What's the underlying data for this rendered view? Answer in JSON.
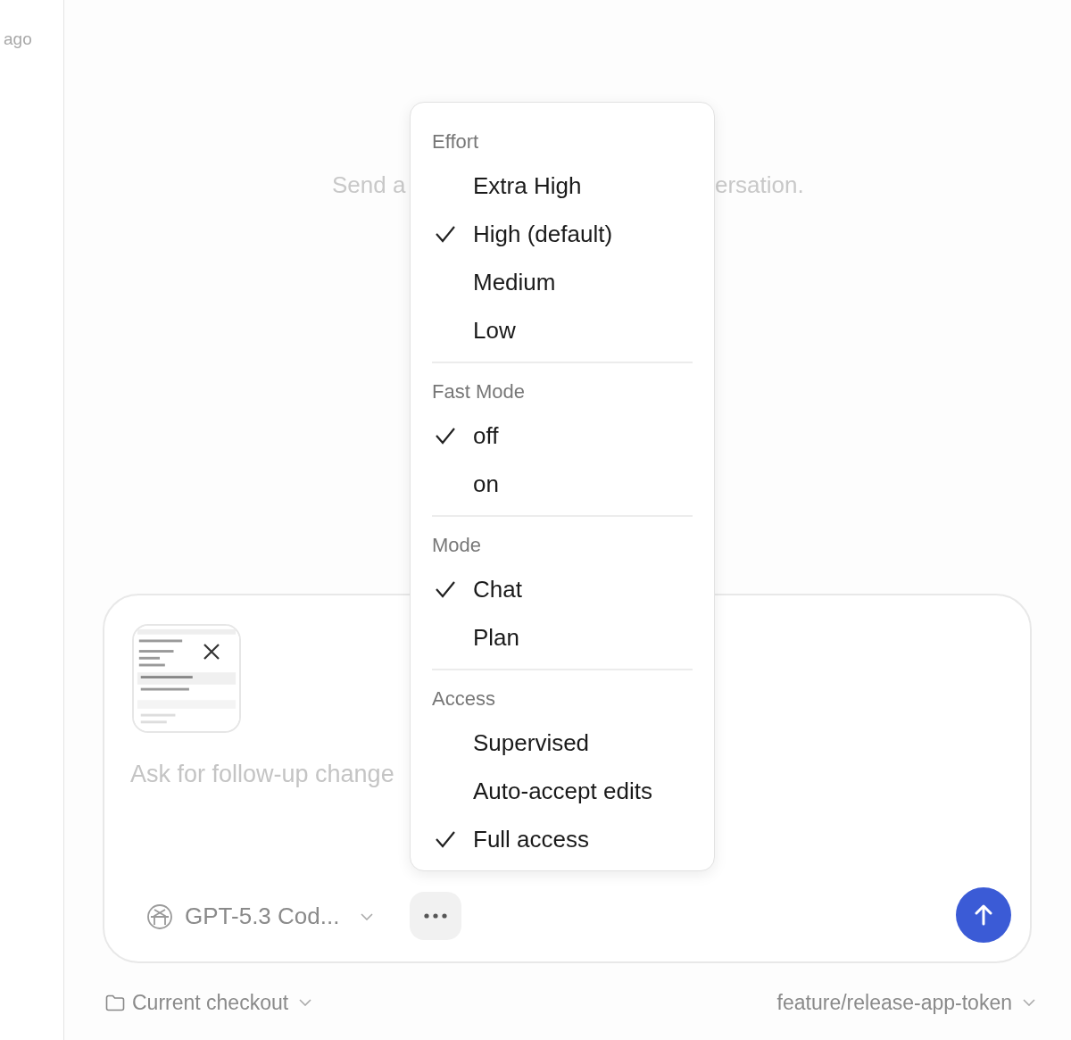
{
  "sidebar": {
    "time": "ago"
  },
  "empty_state": {
    "left": "Send a",
    "right": "ersation."
  },
  "menu": {
    "sections": [
      {
        "title": "Effort",
        "items": [
          {
            "label": "Extra High",
            "selected": false
          },
          {
            "label": "High (default)",
            "selected": true
          },
          {
            "label": "Medium",
            "selected": false
          },
          {
            "label": "Low",
            "selected": false
          }
        ]
      },
      {
        "title": "Fast Mode",
        "items": [
          {
            "label": "off",
            "selected": true
          },
          {
            "label": "on",
            "selected": false
          }
        ]
      },
      {
        "title": "Mode",
        "items": [
          {
            "label": "Chat",
            "selected": true
          },
          {
            "label": "Plan",
            "selected": false
          }
        ]
      },
      {
        "title": "Access",
        "items": [
          {
            "label": "Supervised",
            "selected": false
          },
          {
            "label": "Auto-accept edits",
            "selected": false
          },
          {
            "label": "Full access",
            "selected": true
          }
        ]
      }
    ]
  },
  "composer": {
    "placeholder": "Ask for follow-up change",
    "model": "GPT-5.3 Cod..."
  },
  "footer": {
    "checkout": "Current checkout",
    "branch": "feature/release-app-token"
  }
}
